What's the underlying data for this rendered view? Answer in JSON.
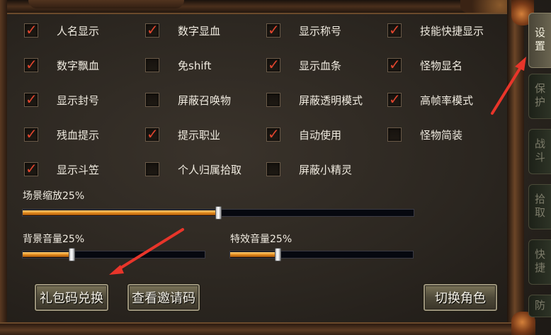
{
  "tabs": [
    {
      "label": "设置",
      "active": true
    },
    {
      "label": "保护",
      "active": false
    },
    {
      "label": "战斗",
      "active": false
    },
    {
      "label": "拾取",
      "active": false
    },
    {
      "label": "快捷",
      "active": false
    },
    {
      "label": "防",
      "active": false
    }
  ],
  "options": [
    {
      "label": "人名显示",
      "checked": true
    },
    {
      "label": "数字显血",
      "checked": true
    },
    {
      "label": "显示称号",
      "checked": true
    },
    {
      "label": "技能快捷显示",
      "checked": true
    },
    {
      "label": "数字飘血",
      "checked": true
    },
    {
      "label": "免shift",
      "checked": false
    },
    {
      "label": "显示血条",
      "checked": true
    },
    {
      "label": "怪物显名",
      "checked": true
    },
    {
      "label": "显示封号",
      "checked": true
    },
    {
      "label": "屏蔽召唤物",
      "checked": false
    },
    {
      "label": "屏蔽透明模式",
      "checked": false
    },
    {
      "label": "高帧率模式",
      "checked": true
    },
    {
      "label": "残血提示",
      "checked": true
    },
    {
      "label": "提示职业",
      "checked": true
    },
    {
      "label": "自动使用",
      "checked": true
    },
    {
      "label": "怪物简装",
      "checked": false
    },
    {
      "label": "显示斗笠",
      "checked": true
    },
    {
      "label": "个人归属拾取",
      "checked": false
    },
    {
      "label": "屏蔽小精灵",
      "checked": false
    }
  ],
  "check_mark": "✓",
  "sliders": {
    "scene_zoom": {
      "label": "场景缩放25%",
      "level": 0.5
    },
    "bg_volume": {
      "label": "背景音量25%",
      "level": 0.27
    },
    "fx_volume": {
      "label": "特效音量25%",
      "level": 0.26
    }
  },
  "buttons": {
    "redeem": "礼包码兑换",
    "invite": "查看邀请码",
    "switch_role": "切换角色"
  },
  "colors": {
    "check": "#e0452e",
    "slider_fill": "#e2881a",
    "annotation_arrow": "#e8352a"
  }
}
